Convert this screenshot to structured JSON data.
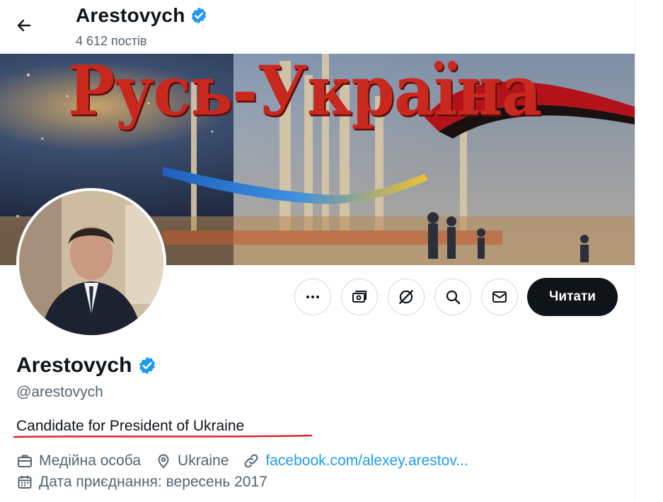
{
  "header": {
    "name": "Arestovych",
    "posts_count": "4 612 постів"
  },
  "banner": {
    "title": "Русь-Україна"
  },
  "actions": {
    "follow_label": "Читати"
  },
  "profile": {
    "name": "Arestovych",
    "handle": "@arestovych",
    "bio": "Candidate for President of Ukraine",
    "category": "Медійна особа",
    "location": "Ukraine",
    "link": "facebook.com/alexey.arestov...",
    "joined": "Дата приєднання: вересень 2017"
  },
  "colors": {
    "verified": "#1d9bf0",
    "link": "#1d9bf0",
    "follow_button": "#0f1419",
    "bio_underline": "#e0242e"
  }
}
